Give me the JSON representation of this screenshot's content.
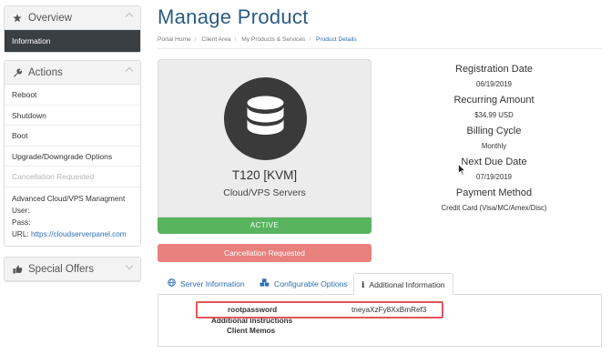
{
  "sidebar": {
    "overview": {
      "title": "Overview",
      "items": [
        "Information"
      ]
    },
    "actions": {
      "title": "Actions",
      "items": [
        "Reboot",
        "Shutdown",
        "Boot",
        "Upgrade/Downgrade Options",
        "Cancellation Requested"
      ],
      "details": {
        "title": "Advanced Cloud/VPS Managment",
        "user_label": "User:",
        "pass_label": "Pass:",
        "url_label": "URL:",
        "url": "https://cloudserverpanel.com"
      }
    },
    "special_offers": {
      "title": "Special Offers"
    }
  },
  "header": {
    "title": "Manage Product",
    "breadcrumb": [
      "Portal Home",
      "Client Area",
      "My Products & Services",
      "Product Details"
    ]
  },
  "product": {
    "name": "T120 [KVM]",
    "group": "Cloud/VPS Servers",
    "status": "ACTIVE",
    "cancel_label": "Cancellation Requested",
    "icon": "database-icon"
  },
  "details": {
    "registration_label": "Registration Date",
    "registration_value": "06/19/2019",
    "recurring_label": "Recurring Amount",
    "recurring_value": "$34.99 USD",
    "cycle_label": "Billing Cycle",
    "cycle_value": "Monthly",
    "due_label": "Next Due Date",
    "due_value": "07/19/2019",
    "payment_label": "Payment Method",
    "payment_value": "Credit Card (Visa/MC/Amex/Disc)"
  },
  "tabs": [
    {
      "label": "Server Information",
      "icon": "globe-icon"
    },
    {
      "label": "Configurable Options",
      "icon": "cubes-icon"
    },
    {
      "label": "Additional Information",
      "icon": "info-icon"
    }
  ],
  "additional_info": {
    "rootpassword_label": "rootpassword",
    "rootpassword_value": "tneyaXzFy8XxBmRef3",
    "instructions_label": "Additional Instructions",
    "memos_label": "Client Memos"
  },
  "colors": {
    "title": "#2a5b86",
    "active_nav": "#3a3f44",
    "status_active": "#58b45f",
    "cancel": "#e8807c",
    "highlight": "#e0565b",
    "link": "#2a6fb3"
  }
}
